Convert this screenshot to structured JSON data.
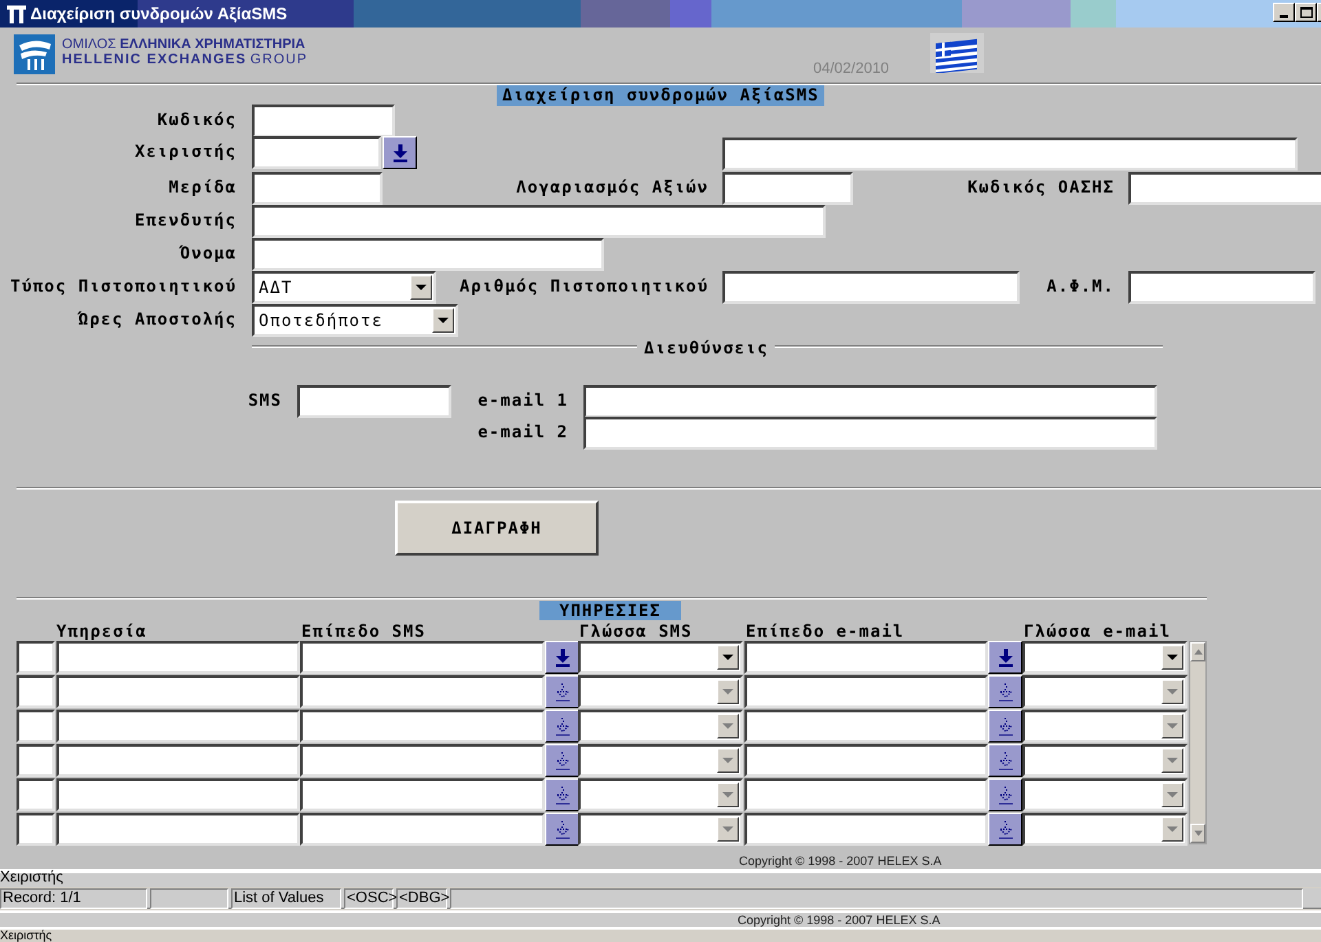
{
  "window": {
    "title": "Διαχείριση συνδρομών ΑξίαSMS"
  },
  "header": {
    "logo_line_1a": "ΟΜΙΛΟΣ",
    "logo_line_1b": "ΕΛΛΗΝΙΚΑ ΧΡΗΜΑΤΙΣΤΗΡΙΑ",
    "logo_line_2a": "HELLENIC EXCHANGES",
    "logo_line_2b": "GROUP",
    "date": "04/02/2010"
  },
  "form": {
    "title": "Διαχείριση συνδρομών ΑξίαSMS",
    "fields": [
      {
        "label": "Κωδικός",
        "kind": "text"
      },
      {
        "label": "Χειριστής",
        "kind": "lov"
      },
      {
        "kind": "text"
      },
      {
        "label": "Μερίδα",
        "kind": "text"
      },
      {
        "label": "Λογαριασμός Αξιών",
        "kind": "text"
      },
      {
        "label": "Κωδικός ΟΑΣΗΣ",
        "kind": "text"
      },
      {
        "label": "Επενδυτής",
        "kind": "text"
      },
      {
        "label": "Όνομα",
        "kind": "text"
      },
      {
        "label": "Τύπος Πιστοποιητικού",
        "kind": "select",
        "value": "ΑΔΤ"
      },
      {
        "label": "Αριθμός Πιστοποιητικού",
        "kind": "text"
      },
      {
        "label": "Α.Φ.Μ.",
        "kind": "text"
      },
      {
        "label": "Ώρες Αποστολής",
        "kind": "select",
        "value": "Οποτεδήποτε"
      }
    ],
    "addresses_title": "Διευθύνσεις",
    "addresses": [
      {
        "label": "SMS"
      },
      {
        "label": "e-mail 1"
      },
      {
        "label": "e-mail 2"
      }
    ],
    "delete_button": "ΔΙΑΓΡΑΦΗ"
  },
  "services": {
    "title": "ΥΠΗΡΕΣΙΕΣ",
    "columns": [
      "Υπηρεσία",
      "Επίπεδο SMS",
      "Γλώσσα SMS",
      "Επίπεδο e-mail",
      "Γλώσσα e-mail"
    ],
    "rows": [
      {
        "current": true
      },
      {
        "current": false
      },
      {
        "current": false
      },
      {
        "current": false
      },
      {
        "current": false
      },
      {
        "current": false
      }
    ]
  },
  "copyright": "Copyright © 1998 - 2007 HELEX S.A",
  "hint_line": "Χειριστής",
  "status_bar": [
    "Record: 1/1",
    "List of Values",
    "<OSC>",
    "<DBG>"
  ],
  "footer_copyright": "Copyright © 1998 - 2007 HELEX S.A",
  "bottom_hint": "Χειριστής"
}
